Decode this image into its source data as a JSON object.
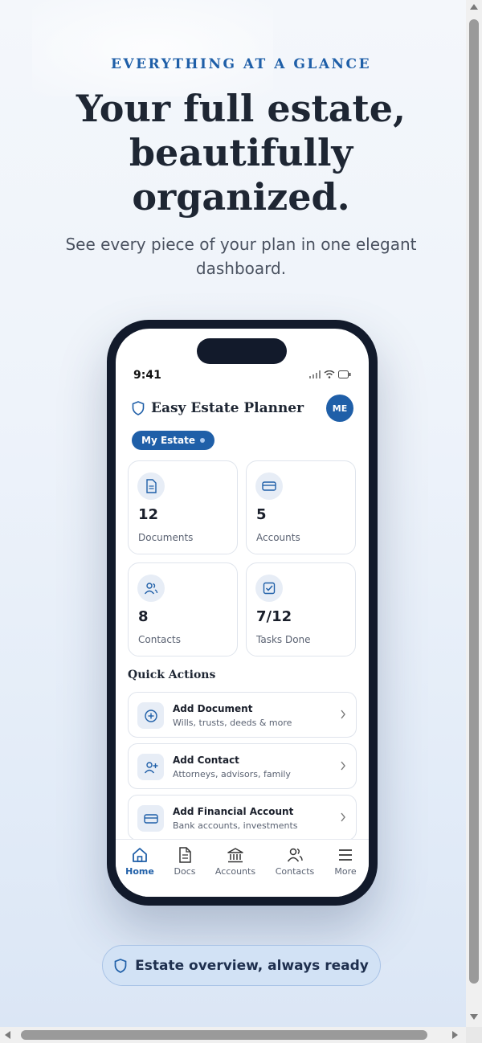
{
  "hero": {
    "eyebrow": "EVERYTHING AT A GLANCE",
    "headline_line1": "Your full estate,",
    "headline_line2": "beautifully",
    "headline_line3": "organized.",
    "subhead": "See every piece of your plan in one elegant dashboard."
  },
  "phone": {
    "status_time": "9:41",
    "app_title": "Easy Estate Planner",
    "avatar_initials": "ME",
    "estate_pill": "My Estate",
    "stats": [
      {
        "value": "12",
        "label": "Documents",
        "icon": "document-icon"
      },
      {
        "value": "5",
        "label": "Accounts",
        "icon": "card-icon"
      },
      {
        "value": "8",
        "label": "Contacts",
        "icon": "people-icon"
      },
      {
        "value": "7/12",
        "label": "Tasks Done",
        "icon": "checkbox-icon"
      }
    ],
    "quick_actions_title": "Quick Actions",
    "actions": [
      {
        "title": "Add Document",
        "subtitle": "Wills, trusts, deeds & more",
        "icon": "plus-circle-icon"
      },
      {
        "title": "Add Contact",
        "subtitle": "Attorneys, advisors, family",
        "icon": "add-person-icon"
      },
      {
        "title": "Add Financial Account",
        "subtitle": "Bank accounts, investments",
        "icon": "card-icon"
      }
    ],
    "tabs": [
      {
        "label": "Home",
        "icon": "home-icon",
        "active": true
      },
      {
        "label": "Docs",
        "icon": "document-icon"
      },
      {
        "label": "Accounts",
        "icon": "bank-icon"
      },
      {
        "label": "Contacts",
        "icon": "people-icon"
      },
      {
        "label": "More",
        "icon": "menu-icon"
      }
    ]
  },
  "badge": {
    "label": "Estate overview, always ready",
    "icon": "shield-icon"
  },
  "colors": {
    "accent": "#1f5fa8",
    "dark": "#121a2b",
    "text": "#1e2633"
  }
}
